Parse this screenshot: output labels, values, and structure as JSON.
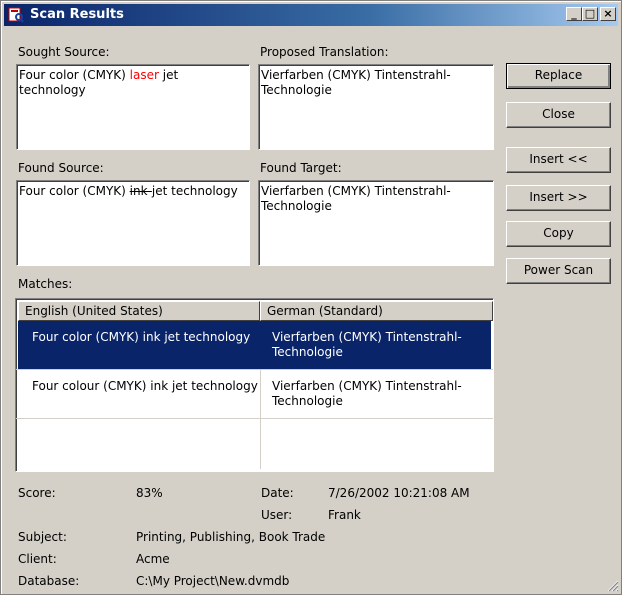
{
  "window": {
    "title": "Scan Results",
    "controls": {
      "minimize": "_",
      "maximize": "□",
      "close": "×"
    }
  },
  "sought_source": {
    "label": "Sought Source:",
    "before": "Four color (CMYK) ",
    "highlight": "laser",
    "after": " jet technology"
  },
  "proposed_translation": {
    "label": "Proposed Translation:",
    "text": "Vierfarben (CMYK) Tintenstrahl-Technologie"
  },
  "found_source": {
    "label": "Found Source:",
    "before": "Four color (CMYK) ",
    "strike": "ink-",
    "after": "jet technology"
  },
  "found_target": {
    "label": "Found Target:",
    "text": "Vierfarben (CMYK) Tintenstrahl-Technologie"
  },
  "buttons": {
    "replace": "Replace",
    "close": "Close",
    "insert_before": "Insert <<",
    "insert_after": "Insert >>",
    "copy": "Copy",
    "power_scan": "Power Scan"
  },
  "matches": {
    "label": "Matches:",
    "columns": [
      "English (United States)",
      "German (Standard)"
    ],
    "rows": [
      {
        "source": "Four color (CMYK) ink jet technology",
        "target": "Vierfarben (CMYK) Tintenstrahl-Technologie",
        "selected": true
      },
      {
        "source": "Four colour (CMYK) ink jet technology",
        "target": "Vierfarben (CMYK) Tintenstrahl-Technologie",
        "selected": false
      }
    ]
  },
  "info": {
    "score_label": "Score:",
    "score_value": "83%",
    "date_label": "Date:",
    "date_value": "7/26/2002 10:21:08 AM",
    "user_label": "User:",
    "user_value": "Frank",
    "subject_label": "Subject:",
    "subject_value": "Printing, Publishing, Book Trade",
    "client_label": "Client:",
    "client_value": "Acme",
    "database_label": "Database:",
    "database_value": "C:\\My Project\\New.dvmdb"
  },
  "colors": {
    "titlebar_start": "#0a246a",
    "titlebar_end": "#a6caf0",
    "selection": "#0a246a",
    "highlight_red": "#ff0000",
    "face": "#d4d0c8"
  }
}
